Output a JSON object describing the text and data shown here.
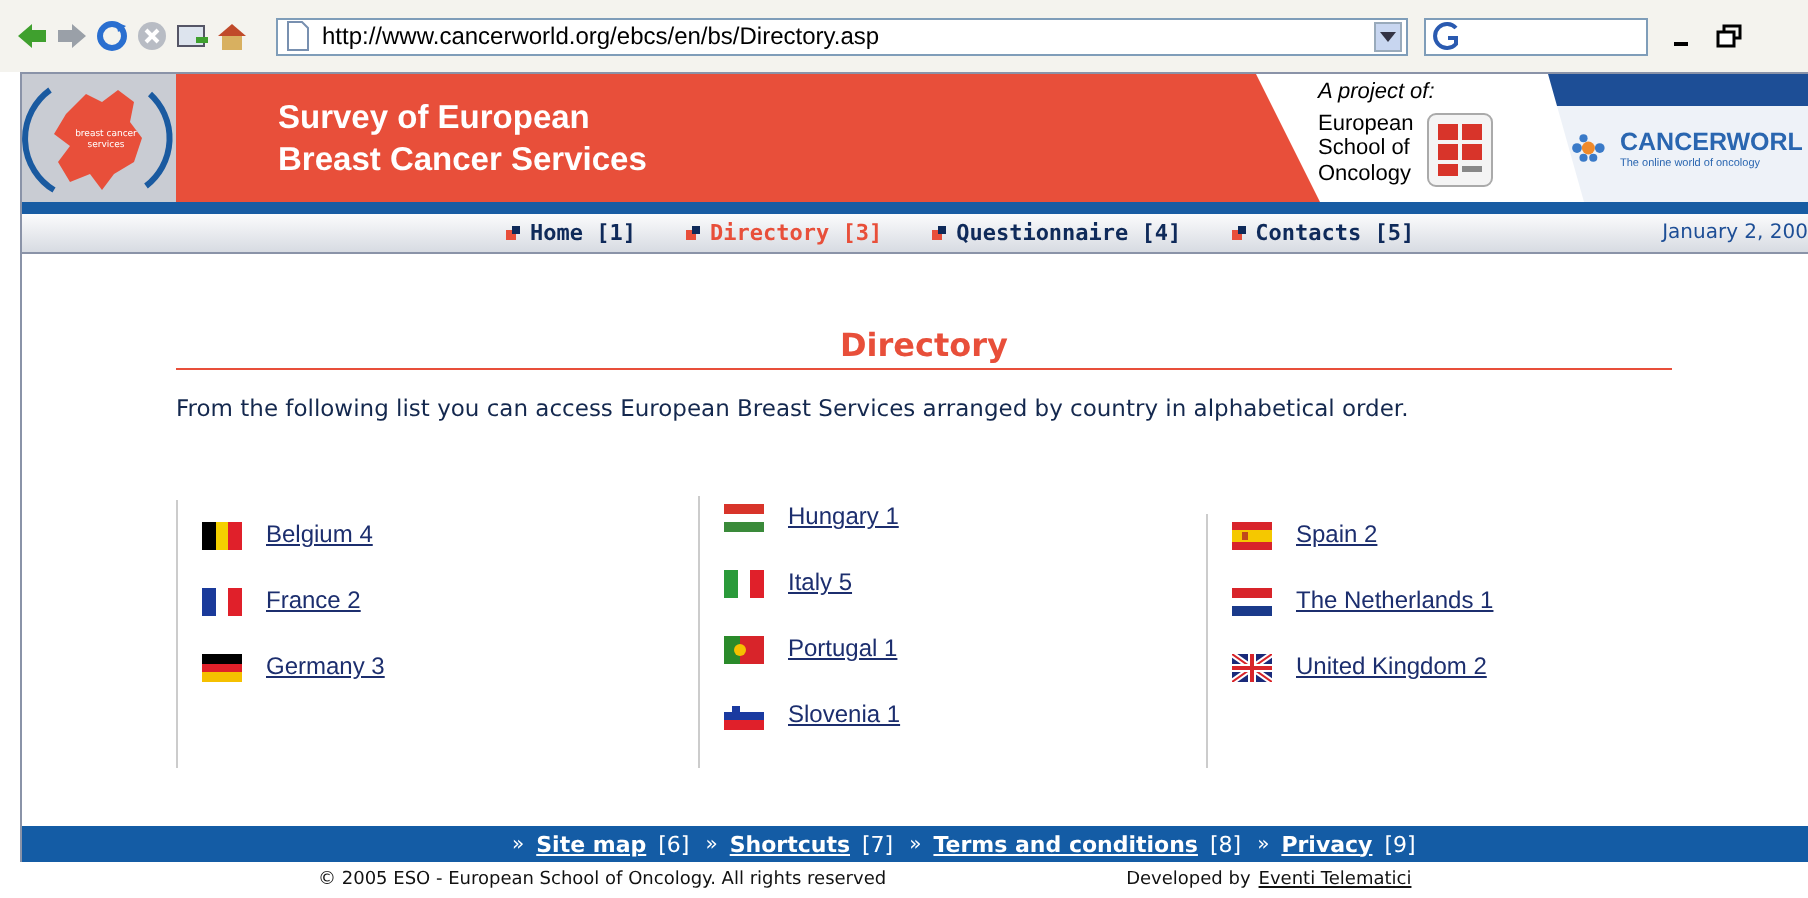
{
  "browser": {
    "url": "http://www.cancerworld.org/ebcs/en/bs/Directory.asp"
  },
  "header": {
    "logo_text_lines": [
      "breast cancer",
      "services"
    ],
    "title_lines": [
      "Survey of European",
      "Breast Cancer Services"
    ],
    "project_label": "A project of:",
    "school_lines": [
      "European",
      "School of",
      "Oncology"
    ],
    "partner_name": "CANCERWORL",
    "partner_tagline": "The online world of oncology"
  },
  "nav": {
    "items": [
      {
        "label": "Home [1]",
        "selected": false
      },
      {
        "label": "Directory [3]",
        "selected": true
      },
      {
        "label": "Questionnaire [4]",
        "selected": false
      },
      {
        "label": "Contacts [5]",
        "selected": false
      }
    ],
    "date": "January 2, 200"
  },
  "heading": "Directory",
  "intro": "From the following list you can access European Breast Services arranged by country in alphabetical order.",
  "columns": [
    [
      {
        "label": "Belgium 4",
        "kind": "be"
      },
      {
        "label": "France 2",
        "kind": "fr"
      },
      {
        "label": "Germany 3",
        "kind": "de"
      }
    ],
    [
      {
        "label": "Hungary 1",
        "kind": "hu"
      },
      {
        "label": "Italy 5",
        "kind": "it"
      },
      {
        "label": "Portugal 1",
        "kind": "pt"
      },
      {
        "label": "Slovenia 1",
        "kind": "si"
      }
    ],
    [
      {
        "label": "Spain 2",
        "kind": "es"
      },
      {
        "label": "The Netherlands 1",
        "kind": "nl"
      },
      {
        "label": "United Kingdom 2",
        "kind": "uk"
      }
    ]
  ],
  "footer": {
    "links": [
      {
        "separator": "»",
        "label": "Site map",
        "key": "[6]"
      },
      {
        "separator": "»",
        "label": "Shortcuts",
        "key": "[7]"
      },
      {
        "separator": "»",
        "label": "Terms and conditions",
        "key": "[8]"
      },
      {
        "separator": "»",
        "label": "Privacy",
        "key": "[9]"
      }
    ],
    "copyright": "© 2005 ESO - European School of Oncology. All rights reserved",
    "developed_label": "Developed by",
    "developer": "Eventi Telematici"
  }
}
